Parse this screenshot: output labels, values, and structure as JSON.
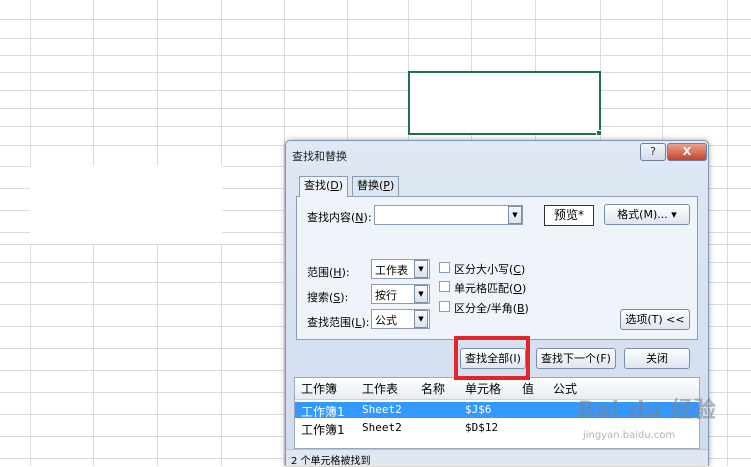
{
  "dialog": {
    "title": "查找和替换",
    "help": "?",
    "close": "X"
  },
  "tabs": [
    {
      "label": "查找(",
      "key": "D",
      "suffix": ")"
    },
    {
      "label": "替换(",
      "key": "P",
      "suffix": ")"
    }
  ],
  "find": {
    "label": "查找内容(",
    "key": "N",
    "suffix": "):",
    "value": "",
    "preview": "预览*",
    "format_btn": "格式(M)...",
    "format_arrow": "▾"
  },
  "options": {
    "scope": {
      "label": "范围(",
      "key": "H",
      "suffix": "):",
      "value": "工作表"
    },
    "search": {
      "label": "搜索(",
      "key": "S",
      "suffix": "):",
      "value": "按行"
    },
    "lookin": {
      "label": "查找范围(",
      "key": "L",
      "suffix": "):",
      "value": "公式"
    },
    "match_case": {
      "label": "区分大小写(",
      "key": "C",
      "suffix": ")",
      "checked": false
    },
    "match_cell": {
      "label": "单元格匹配(",
      "key": "O",
      "suffix": ")",
      "checked": false
    },
    "match_width": {
      "label": "区分全/半角(",
      "key": "B",
      "suffix": ")",
      "checked": false
    },
    "options_btn": "选项(T) <<"
  },
  "buttons": {
    "find_all": "查找全部(I)",
    "find_next": "查找下一个(F)",
    "close": "关闭"
  },
  "results": {
    "columns": [
      "工作簿",
      "工作表",
      "名称",
      "单元格",
      "值",
      "公式"
    ],
    "rows": [
      {
        "workbook": "工作簿1",
        "sheet": "Sheet2",
        "name": "",
        "cell": "$J$6",
        "value": "",
        "formula": "",
        "selected": true
      },
      {
        "workbook": "工作簿1",
        "sheet": "Sheet2",
        "name": "",
        "cell": "$D$12",
        "value": "",
        "formula": "",
        "selected": false
      }
    ]
  },
  "status": "2 个单元格被找到",
  "watermark": {
    "logo": "Bai du 经验",
    "url": "jingyan.baidu.com"
  },
  "colors": {
    "selection_accent": "#217346",
    "highlight_box": "#e0262a",
    "selected_row": "#3399ff"
  }
}
